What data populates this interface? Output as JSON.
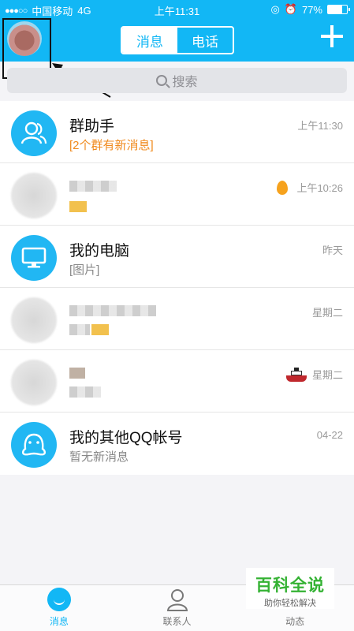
{
  "status_bar": {
    "signal": "●●●○○",
    "carrier": "中国移动",
    "network": "4G",
    "time": "上午11:31",
    "battery": "77%",
    "battery_level": 0.77
  },
  "header": {
    "tabs": [
      {
        "label": "消息",
        "active": true
      },
      {
        "label": "电话",
        "active": false
      }
    ]
  },
  "search": {
    "placeholder": "搜索"
  },
  "conversations": [
    {
      "title": "群助手",
      "subtitle": "[2个群有新消息]",
      "time": "上午11:30",
      "icon": "group-assistant-icon"
    },
    {
      "title": "",
      "subtitle": "",
      "time": "上午10:26",
      "icon": "flame-icon"
    },
    {
      "title": "我的电脑",
      "subtitle": "[图片]",
      "time": "昨天",
      "icon": "monitor-icon"
    },
    {
      "title": "",
      "subtitle": "",
      "time": "星期二",
      "icon": ""
    },
    {
      "title": "",
      "subtitle": "",
      "time": "星期二",
      "icon": "ship-icon"
    },
    {
      "title": "我的其他QQ帐号",
      "subtitle": "暂无新消息",
      "time": "04-22",
      "icon": "other-accounts-icon"
    }
  ],
  "tabbar": {
    "items": [
      {
        "label": "消息",
        "icon": "message-icon",
        "active": true
      },
      {
        "label": "联系人",
        "icon": "contacts-icon",
        "active": false
      },
      {
        "label": "动态",
        "icon": "moments-icon",
        "active": false
      }
    ]
  },
  "watermark": {
    "title": "百科全说",
    "subtitle": "助你轻松解决"
  },
  "colors": {
    "brand": "#12b7f5",
    "highlight": "#f08a1d",
    "watermark": "#34b233"
  }
}
